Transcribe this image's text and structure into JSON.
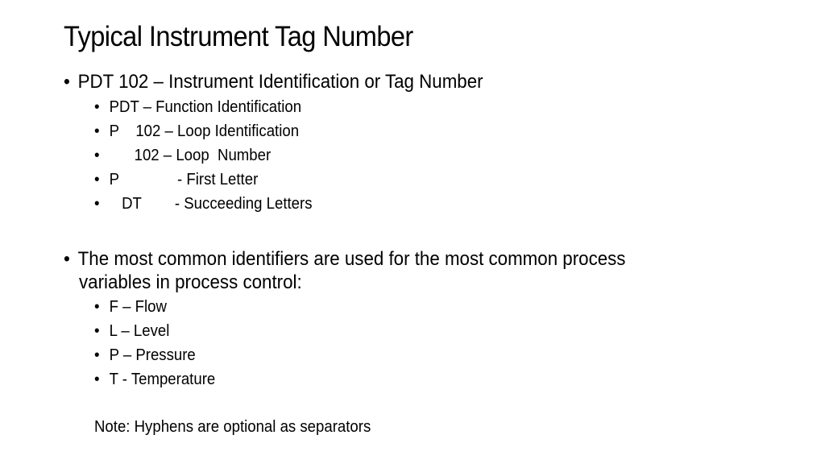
{
  "slide": {
    "title": "Typical Instrument Tag Number",
    "section1": {
      "bullet": "•",
      "heading": "PDT 102 – Instrument Identification or Tag Number",
      "items": [
        {
          "bullet": "•",
          "text": "PDT – Function Identification"
        },
        {
          "bullet": "•",
          "text": "P    102 – Loop Identification"
        },
        {
          "bullet": "•",
          "text": "      102 – Loop  Number"
        },
        {
          "bullet": "•",
          "text": "P              - First Letter"
        },
        {
          "bullet": "•",
          "text": "   DT        - Succeeding Letters"
        }
      ]
    },
    "section2": {
      "bullet": "•",
      "heading_line1": "The most common identifiers are used for the most common process",
      "heading_line2": "variables in process control:",
      "items": [
        {
          "bullet": "•",
          "text": "F – Flow"
        },
        {
          "bullet": "•",
          "text": "L – Level"
        },
        {
          "bullet": "•",
          "text": "P – Pressure"
        },
        {
          "bullet": "•",
          "text": "T - Temperature"
        }
      ]
    },
    "note": "Note: Hyphens are optional as separators"
  }
}
